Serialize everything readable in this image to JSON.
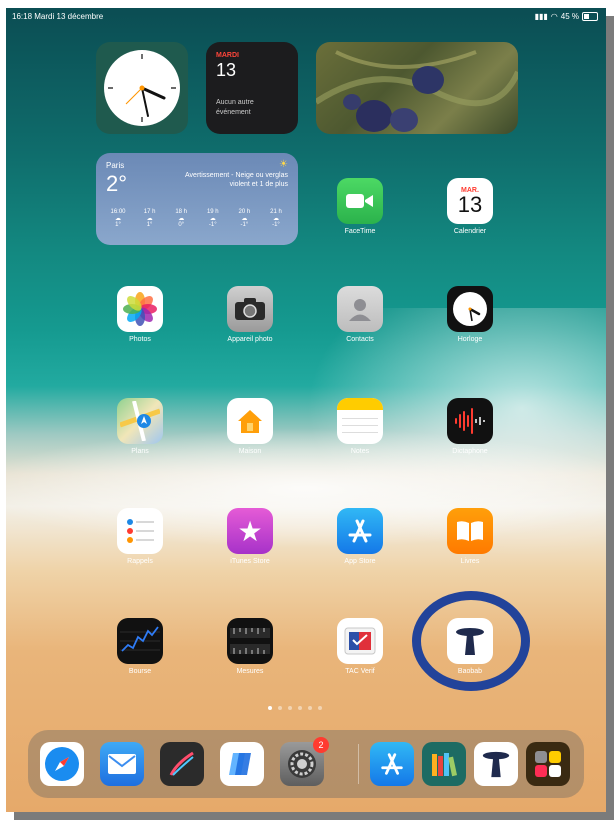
{
  "status_bar": {
    "time": "16:18",
    "date": "Mardi 13 décembre",
    "battery": "45 %",
    "battery_level": 0.45
  },
  "widgets": {
    "calendar": {
      "dow": "MARDI",
      "day": "13",
      "event_text": "Aucun autre événement"
    },
    "weather": {
      "city": "Paris",
      "temp": "2°",
      "alert": "Avertissement - Neige ou verglas violent et 1 de plus",
      "hours": [
        {
          "time": "16:00",
          "temp": "1°"
        },
        {
          "time": "17 h",
          "temp": "1°"
        },
        {
          "time": "18 h",
          "temp": "0°"
        },
        {
          "time": "19 h",
          "temp": "-1°"
        },
        {
          "time": "20 h",
          "temp": "-1°"
        },
        {
          "time": "21 h",
          "temp": "-1°"
        }
      ]
    }
  },
  "apps": {
    "facetime": "FaceTime",
    "calendrier": "Calendrier",
    "calendrier_dow": "MAR.",
    "calendrier_day": "13",
    "photos": "Photos",
    "appareil_photo": "Appareil photo",
    "contacts": "Contacts",
    "horloge": "Horloge",
    "plans": "Plans",
    "maison": "Maison",
    "notes": "Notes",
    "dictaphone": "Dictaphone",
    "rappels": "Rappels",
    "itunes_store": "iTunes Store",
    "app_store": "App Store",
    "livres": "Livres",
    "bourse": "Bourse",
    "mesures": "Mesures",
    "tac_verif": "TAC Verif",
    "baobab": "Baobab"
  },
  "dock": {
    "settings_badge": "2"
  },
  "page_dots": {
    "count": 6,
    "active": 0
  },
  "colors": {
    "highlight_ring": "#22439a",
    "badge": "#ff3b30"
  }
}
